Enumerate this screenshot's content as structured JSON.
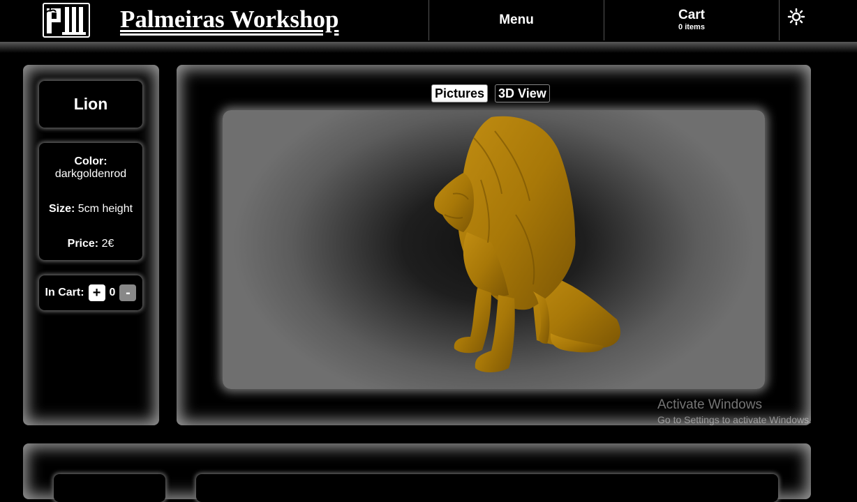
{
  "header": {
    "site_title": "Palmeiras Workshop",
    "menu_label": "Menu",
    "cart": {
      "label": "Cart",
      "count_text": "0 items"
    },
    "logo_text": "P"
  },
  "product": {
    "name": "Lion",
    "color_label": "Color:",
    "color_value": "darkgoldenrod",
    "size_label": "Size:",
    "size_value": "5cm height",
    "price_label": "Price:",
    "price_value": "2€",
    "in_cart_label": "In Cart:",
    "plus_label": "+",
    "quantity": "0",
    "minus_label": "-"
  },
  "view_tabs": [
    {
      "label": "Pictures",
      "active": true
    },
    {
      "label": "3D View",
      "active": false
    }
  ],
  "model": {
    "color": "#b8860b",
    "name": "lion-model"
  },
  "watermark": {
    "line1": "Activate Windows",
    "line2": "Go to Settings to activate Windows."
  }
}
